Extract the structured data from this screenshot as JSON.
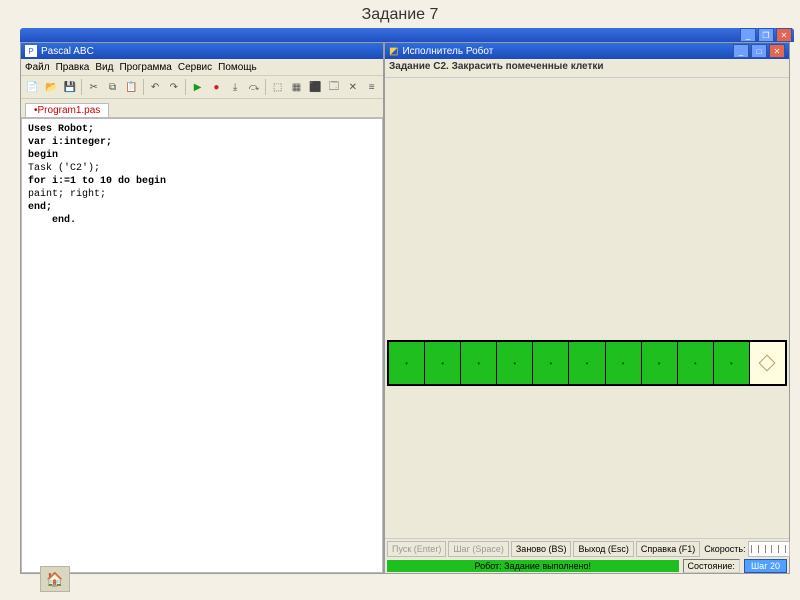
{
  "heading": "Задание 7",
  "ide": {
    "title": "Pascal ABC",
    "menu": [
      "Файл",
      "Правка",
      "Вид",
      "Программа",
      "Сервис",
      "Помощь"
    ],
    "tab": "•Program1.pas",
    "code": [
      "Uses Robot;",
      "var i:integer;",
      "begin",
      "Task ('C2');",
      "for i:=1 to 10 do begin",
      "paint; right;",
      "end;",
      "    end."
    ]
  },
  "robot": {
    "title": "Исполнитель Робот",
    "task": "Задание C2. Закрасить помеченные клетки",
    "buttons": [
      "Пуск (Enter)",
      "Шаг (Space)",
      "Заново (BS)",
      "Выход (Esc)",
      "Справка (F1)"
    ],
    "speed_label": "Скорость:",
    "status_done": "Робот: Задание выполнено!",
    "status_state": "Состояние:",
    "status_step": "Шаг 20",
    "grid": {
      "cols": 11,
      "painted": [
        0,
        1,
        2,
        3,
        4,
        5,
        6,
        7,
        8,
        9
      ],
      "robot_col": 10
    }
  }
}
